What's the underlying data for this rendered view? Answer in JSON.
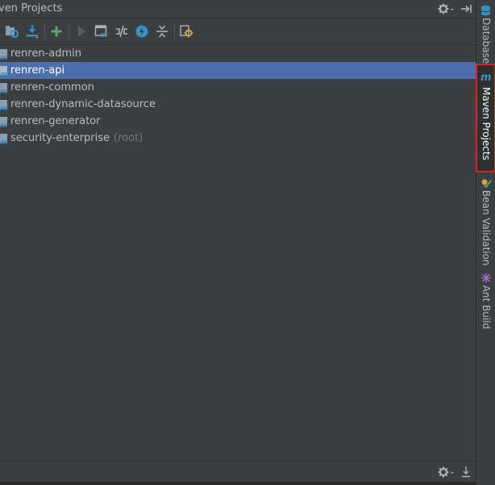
{
  "panel": {
    "title": "ven Projects"
  },
  "toolbar": {
    "buttons": [
      "reimport-all-icon",
      "download-sources-icon",
      "add-maven-project-icon",
      "run-build-icon",
      "execute-goal-icon",
      "toggle-offline-icon",
      "skip-tests-icon",
      "collapse-all-icon",
      "settings-icon"
    ]
  },
  "tree": {
    "items": [
      {
        "label": "renren-admin",
        "extra": ""
      },
      {
        "label": "renren-api",
        "extra": ""
      },
      {
        "label": "renren-common",
        "extra": ""
      },
      {
        "label": "renren-dynamic-datasource",
        "extra": ""
      },
      {
        "label": "renren-generator",
        "extra": ""
      },
      {
        "label": "security-enterprise",
        "extra": "(root)"
      }
    ],
    "selected_index": 1
  },
  "side_tabs": {
    "database": "Database",
    "maven": "Maven Projects",
    "bean_validation": "Bean Validation",
    "ant_build": "Ant Build",
    "active": "Maven Projects"
  },
  "colors": {
    "panel_bg": "#3c3f41",
    "selection": "#4b6eaf",
    "highlight_box": "#e02020",
    "add_green": "#59a869",
    "icon_blue": "#3592c4"
  }
}
